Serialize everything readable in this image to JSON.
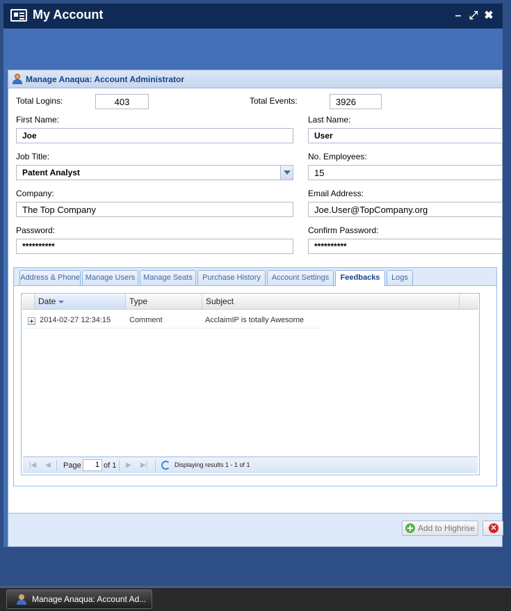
{
  "window": {
    "title": "My Account",
    "controls": [
      "minimize-icon",
      "maximize-icon",
      "close-icon"
    ]
  },
  "dialog": {
    "title": "Manage Anaqua: Account Administrator",
    "form": {
      "total_logins_label": "Total Logins:",
      "total_logins_value": "403",
      "total_events_label": "Total Events:",
      "total_events_value": "3926",
      "first_name_label": "First Name:",
      "first_name_value": "Joe",
      "last_name_label": "Last Name:",
      "last_name_value": "User",
      "job_title_label": "Job Title:",
      "job_title_value": "Patent Analyst",
      "employees_label": "No. Employees:",
      "employees_value": "15",
      "company_label": "Company:",
      "company_value": "The Top Company",
      "email_label": "Email Address:",
      "email_value": "Joe.User@TopCompany.org",
      "password_label": "Password:",
      "password_value": "**********",
      "confirm_password_label": "Confirm Password:",
      "confirm_password_value": "**********"
    },
    "tabs": [
      {
        "label": "Address & Phone",
        "active": false
      },
      {
        "label": "Manage Users",
        "active": false
      },
      {
        "label": "Manage Seats",
        "active": false
      },
      {
        "label": "Purchase History",
        "active": false
      },
      {
        "label": "Account Settings",
        "active": false
      },
      {
        "label": "Feedbacks",
        "active": true
      },
      {
        "label": "Logs",
        "active": false
      }
    ],
    "grid": {
      "columns": [
        "Date",
        "Type",
        "Subject"
      ],
      "rows": [
        {
          "date": "2014-02-27 12:34:15",
          "type": "Comment",
          "subject": "AcclaimIP is totally Awesome"
        }
      ]
    },
    "pager": {
      "page_label": "Page",
      "page_value": "1",
      "of_label": "of 1",
      "display_text": "Displaying results 1 - 1 of 1"
    },
    "footer": {
      "add_button_label": "Add to Highrise"
    }
  },
  "taskbar": {
    "item_label": "Manage Anaqua: Account Ad..."
  }
}
